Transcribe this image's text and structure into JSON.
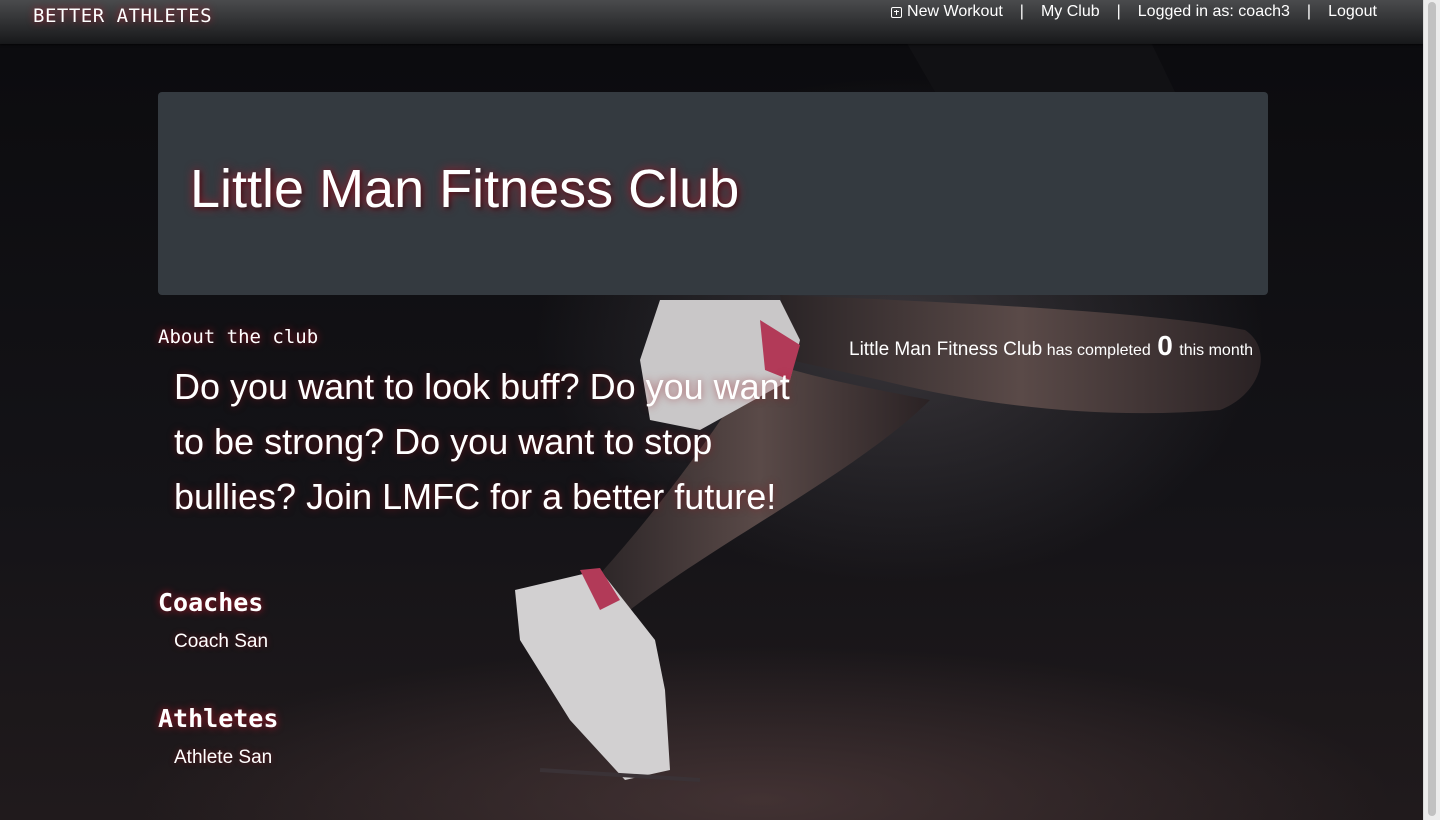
{
  "navbar": {
    "brand": "BETTER ATHLETES",
    "new_workout": "New Workout",
    "my_club": "My Club",
    "logged_in": "Logged in as: coach3",
    "logout": "Logout",
    "separator": "|"
  },
  "club": {
    "name": "Little Man Fitness Club",
    "about_heading": "About the club",
    "about_text": "Do you want to look buff? Do you want to be strong? Do you want to stop bullies? Join LMFC for a better future!",
    "stats_name": "Little Man Fitness Club",
    "stats_prefix": "has completed",
    "stats_count": "0",
    "stats_suffix": "this month"
  },
  "coaches": {
    "heading": "Coaches",
    "items": [
      "Coach San"
    ]
  },
  "athletes": {
    "heading": "Athletes",
    "items": [
      "Athlete San"
    ]
  },
  "colors": {
    "navbar": "#2e2f31",
    "jumbotron": "#343a40",
    "glow": "#be1428"
  }
}
